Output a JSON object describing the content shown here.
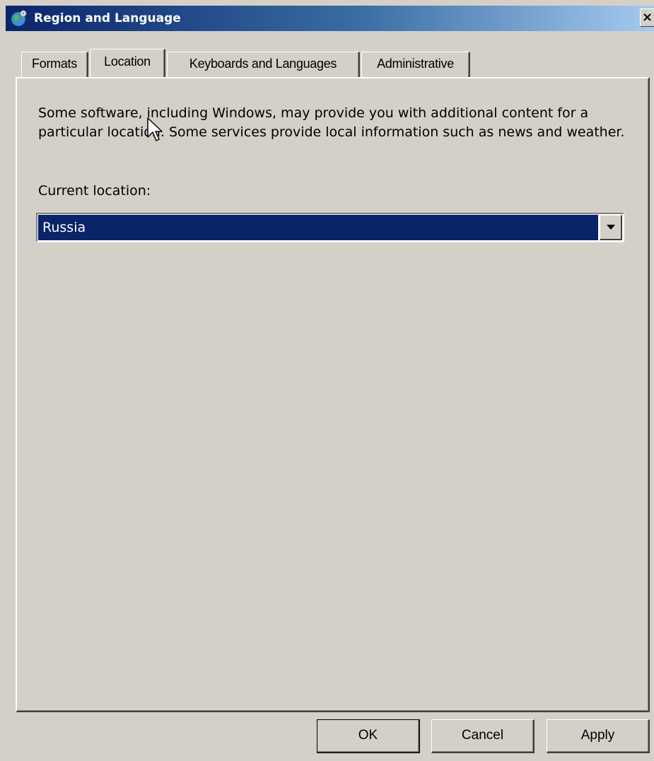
{
  "window": {
    "title": "Region and Language",
    "close_glyph": "×"
  },
  "tabs": [
    {
      "label": "Formats"
    },
    {
      "label": "Location",
      "active": true
    },
    {
      "label": "Keyboards and Languages"
    },
    {
      "label": "Administrative"
    }
  ],
  "location_panel": {
    "description": "Some software, including Windows, may provide you with additional content for a particular location. Some services provide local information such as news and weather.",
    "current_location_label": "Current location:",
    "current_location_value": "Russia"
  },
  "buttons": {
    "ok": "OK",
    "cancel": "Cancel",
    "apply": "Apply"
  },
  "icons": {
    "title_icon": "globe-icon",
    "dropdown_icon": "chevron-down-icon",
    "cursor_icon": "mouse-pointer-icon"
  },
  "colors": {
    "title_bar": "#0a246a",
    "selection": "#0a246a",
    "face": "#d4d0c8"
  }
}
